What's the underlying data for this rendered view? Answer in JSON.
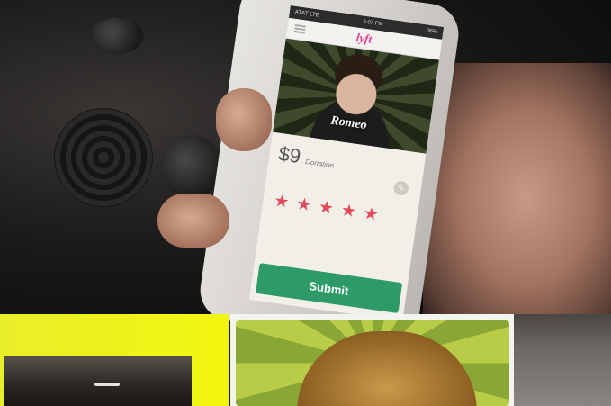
{
  "scene": {
    "description_icons": [
      "car-dashboard",
      "hand",
      "smartphone"
    ],
    "colors": {
      "brand": "#e23c91",
      "star": "#e3495a",
      "submit": "#2d9a68",
      "yellow": "#eef21c"
    }
  },
  "phone": {
    "status": {
      "carrier": "AT&T LTE",
      "time": "6:07 PM",
      "battery": "36%"
    },
    "app_logo": "lyft",
    "driver_name": "Romeo",
    "donation": {
      "amount": "$9",
      "label": "Donation"
    },
    "rating": {
      "stars": 5,
      "max": 5
    },
    "submit_label": "Submit"
  }
}
